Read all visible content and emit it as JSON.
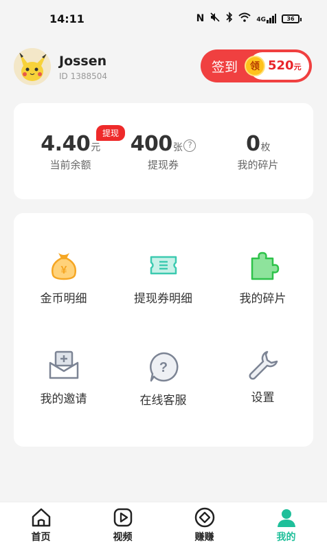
{
  "status_bar": {
    "time": "14:11",
    "network": "4G",
    "battery": "36"
  },
  "profile": {
    "name": "Jossen",
    "id_label": "ID",
    "id_value": "1388504"
  },
  "checkin": {
    "label": "签到",
    "coin_char": "领",
    "amount": "520",
    "unit": "元"
  },
  "stats": {
    "balance": {
      "value": "4.40",
      "unit": "元",
      "label": "当前余额",
      "badge": "提现"
    },
    "vouchers": {
      "value": "400",
      "unit": "张",
      "label": "提现券",
      "help": "?"
    },
    "fragments": {
      "value": "0",
      "unit": "枚",
      "label": "我的碎片"
    }
  },
  "menu": [
    {
      "label": "金币明细",
      "icon": "money-bag-icon",
      "color": "#f5a623"
    },
    {
      "label": "提现券明细",
      "icon": "ticket-icon",
      "color": "#3ccab0"
    },
    {
      "label": "我的碎片",
      "icon": "puzzle-icon",
      "color": "#2ec24a"
    },
    {
      "label": "我的邀请",
      "icon": "invite-envelope-icon",
      "color": "#7c8494"
    },
    {
      "label": "在线客服",
      "icon": "question-chat-icon",
      "color": "#7c8494"
    },
    {
      "label": "设置",
      "icon": "wrench-icon",
      "color": "#7c8494"
    }
  ],
  "tabs": [
    {
      "label": "首页",
      "icon": "home-icon"
    },
    {
      "label": "视频",
      "icon": "video-play-icon"
    },
    {
      "label": "赚赚",
      "icon": "diamond-coin-icon"
    },
    {
      "label": "我的",
      "icon": "person-icon",
      "active": true,
      "color": "#1fbf9a"
    }
  ]
}
